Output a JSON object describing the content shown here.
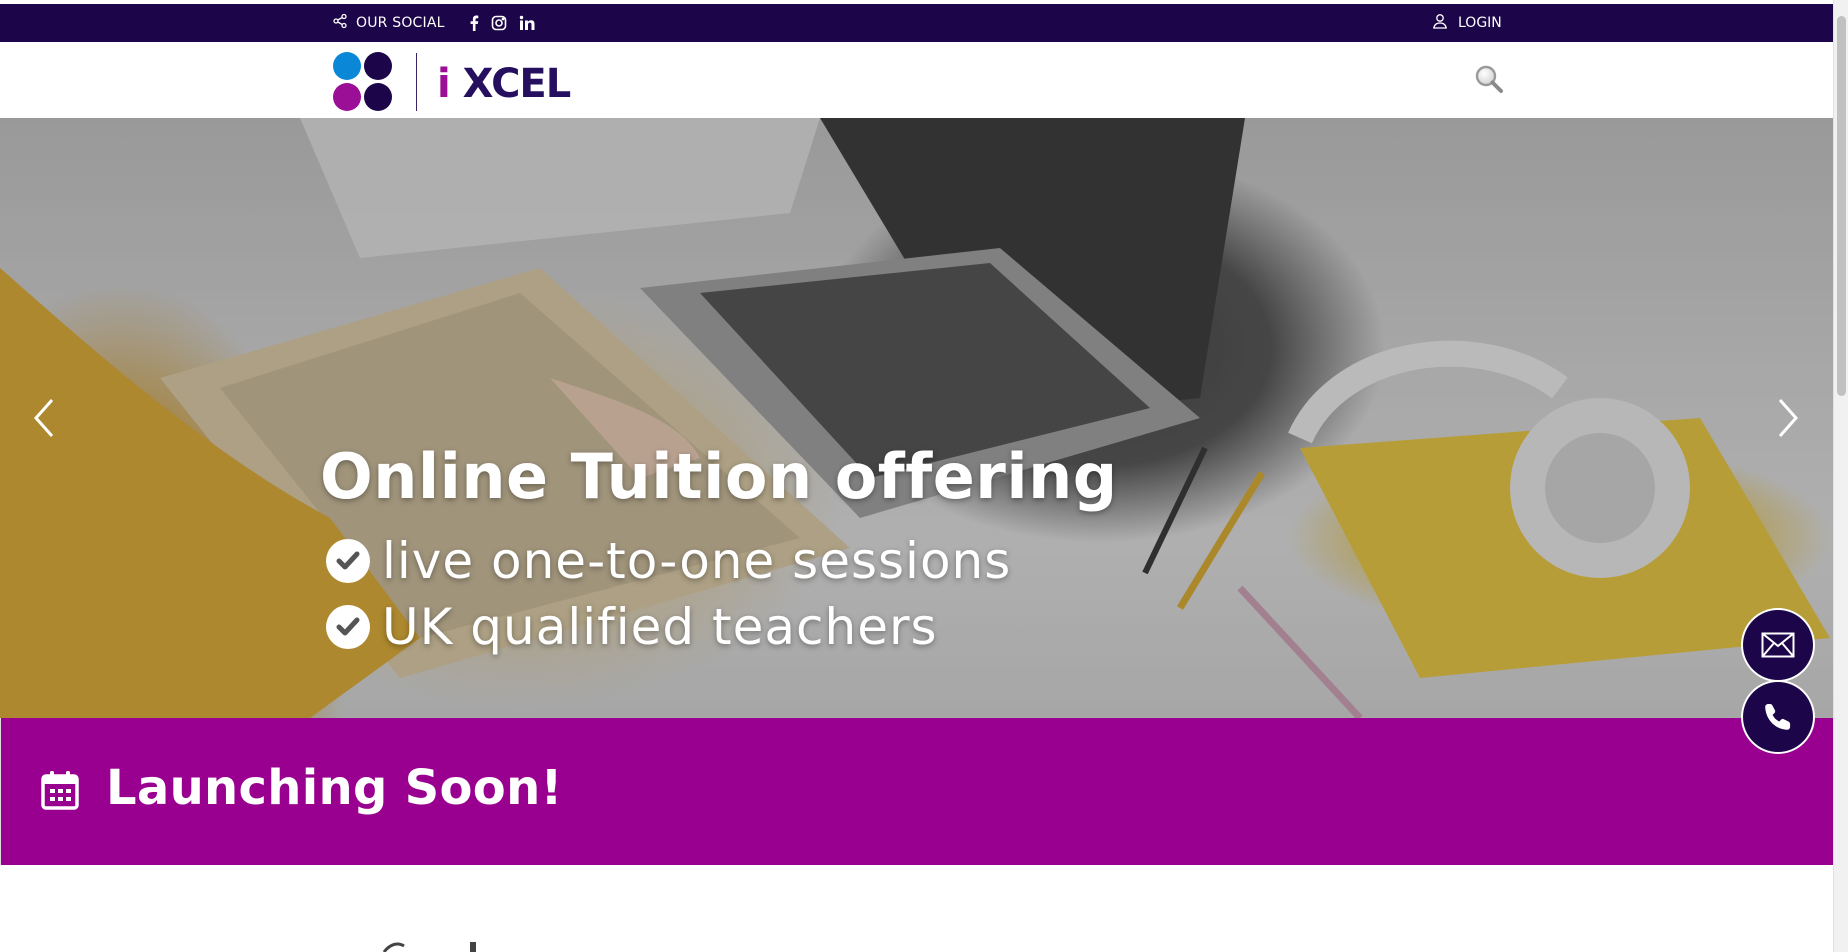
{
  "topbar": {
    "social_label": "OUR SOCIAL",
    "social_icons": [
      "facebook-icon",
      "instagram-icon",
      "linkedin-icon"
    ],
    "login_label": "LOGIN",
    "background": "#1c0649"
  },
  "header": {
    "logo_i": "i",
    "logo_word": "XCEL",
    "logo_colors": [
      "#0a87d6",
      "#1c0649",
      "#9a0f95",
      "#1c0649"
    ]
  },
  "hero": {
    "title": "Online Tuition offering",
    "bullets": [
      "live one-to-one sessions",
      "UK qualified teachers"
    ]
  },
  "banner": {
    "title": "Launching Soon!",
    "background": "#990090"
  },
  "floating": {
    "email_icon": "envelope-icon",
    "phone_icon": "phone-icon"
  }
}
